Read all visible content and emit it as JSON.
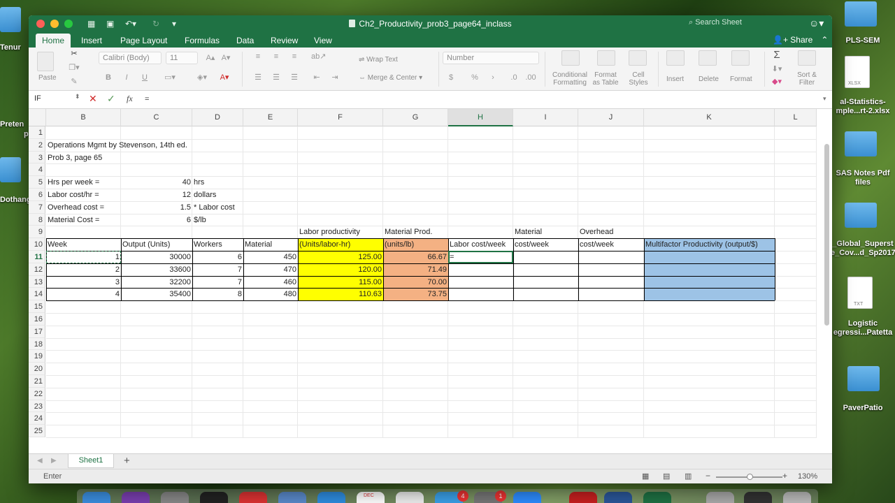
{
  "desktop": {
    "left_labels": [
      "Tenur",
      "Preten",
      "p",
      "Dothang"
    ],
    "right_items": [
      {
        "label": "PLS-SEM"
      },
      {
        "label": "al-Statistics-\nmple...rt-2.xlsx"
      },
      {
        "label": "SAS Notes Pdf\nfiles"
      },
      {
        "label": "_Global_Superst\ne_Cov...d_Sp2017"
      },
      {
        "label": "Logistic\negressi...Patetta"
      },
      {
        "label": "PaverPatio"
      }
    ],
    "file_badges": {
      "xlsx": "XLSX",
      "txt": "TXT"
    },
    "dock_badges": [
      "4",
      "1"
    ],
    "dock_calendar": "DEC"
  },
  "window": {
    "title": "Ch2_Productivity_prob3_page64_inclass",
    "search_placeholder": "Search Sheet"
  },
  "ribbon": {
    "tabs": [
      "Home",
      "Insert",
      "Page Layout",
      "Formulas",
      "Data",
      "Review",
      "View"
    ],
    "active_tab": "Home",
    "share_label": "Share",
    "paste_label": "Paste",
    "font_name": "Calibri (Body)",
    "font_size": "11",
    "wrap_text": "Wrap Text",
    "merge_center": "Merge & Center",
    "number_format": "Number",
    "conditional_formatting": "Conditional\nFormatting",
    "format_as_table": "Format\nas Table",
    "cell_styles": "Cell\nStyles",
    "insert": "Insert",
    "delete": "Delete",
    "format": "Format",
    "sort_filter": "Sort &\nFilter",
    "bold": "B",
    "italic": "I",
    "underline": "U",
    "currency": "$",
    "percent": "%",
    "sum_sign": "Σ"
  },
  "formula_bar": {
    "name_box": "IF",
    "content": "="
  },
  "columns": [
    {
      "letter": "B",
      "w": 107
    },
    {
      "letter": "C",
      "w": 102
    },
    {
      "letter": "D",
      "w": 73
    },
    {
      "letter": "E",
      "w": 78
    },
    {
      "letter": "F",
      "w": 122
    },
    {
      "letter": "G",
      "w": 93
    },
    {
      "letter": "H",
      "w": 93
    },
    {
      "letter": "I",
      "w": 93
    },
    {
      "letter": "J",
      "w": 94
    },
    {
      "letter": "K",
      "w": 187
    },
    {
      "letter": "L",
      "w": 60
    }
  ],
  "rows": [
    "1",
    "2",
    "3",
    "4",
    "5",
    "6",
    "7",
    "8",
    "9",
    "10",
    "11",
    "12",
    "13",
    "14",
    "15",
    "16",
    "17",
    "18",
    "19",
    "20",
    "21",
    "22",
    "23",
    "24",
    "25"
  ],
  "selected_column": "H",
  "selected_row": "11",
  "cells": {
    "B2": "Operations Mgmt by Stevenson, 14th ed.",
    "B3": "Prob 3, page 65",
    "B5": "Hrs per week =",
    "C5": "40",
    "D5": "hrs",
    "B6": "Labor cost/hr =",
    "C6": "12",
    "D6": "dollars",
    "B7": "Overhead cost =",
    "C7": "1.5",
    "D7": "* Labor cost",
    "B8": "Material Cost =",
    "C8": "6",
    "D8": "$/lb",
    "B10": "Week",
    "C10": "Output (Units)",
    "D10": "Workers",
    "E10": "Material",
    "F10a": "Labor productivity",
    "F10b": "(Units/labor-hr)",
    "G10a": "Material Prod.",
    "G10b": "(units/lb)",
    "H10": "Labor cost/week",
    "I10a": "Material",
    "I10b": "cost/week",
    "J10a": "Overhead",
    "J10b": "cost/week",
    "K10": "Multifactor Productivity (output/$)",
    "H11": "="
  },
  "data_rows": [
    {
      "week": "1",
      "output": "30000",
      "workers": "6",
      "material": "450",
      "labor_prod": "125.00",
      "mat_prod": "66.67"
    },
    {
      "week": "2",
      "output": "33600",
      "workers": "7",
      "material": "470",
      "labor_prod": "120.00",
      "mat_prod": "71.49"
    },
    {
      "week": "3",
      "output": "32200",
      "workers": "7",
      "material": "460",
      "labor_prod": "115.00",
      "mat_prod": "70.00"
    },
    {
      "week": "4",
      "output": "35400",
      "workers": "8",
      "material": "480",
      "labor_prod": "110.63",
      "mat_prod": "73.75"
    }
  ],
  "sheet_tab": "Sheet1",
  "status": {
    "mode": "Enter",
    "zoom": "130%"
  },
  "colors": {
    "excel_green": "#1f7244",
    "yellow_fill": "#ffff00",
    "orange_fill": "#f4b183",
    "blue_fill": "#9dc3e6"
  }
}
